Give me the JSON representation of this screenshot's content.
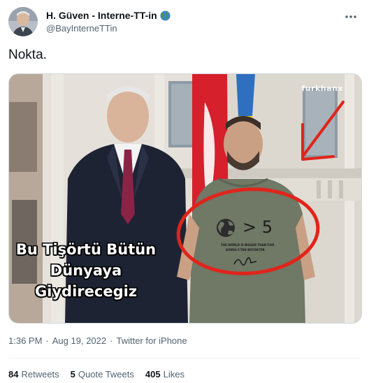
{
  "user": {
    "display_name": "H. Güven - Interne-TT-in",
    "handle": "@BayInterneTTin",
    "badge_icon": "globe-emoji-icon"
  },
  "tweet": {
    "text": "Nokta."
  },
  "media": {
    "watermark": "furkhanx",
    "caption_lines": [
      "Bu Tişörtü Bütün",
      "Dünyaya",
      "Giydirecegiz"
    ],
    "shirt_symbol": "> 5",
    "shirt_small_line1": "THE WORLD IS BIGGER THAN FIVE",
    "shirt_small_line2": "DÜNYA 5'TEN BÜYÜKTÜR",
    "annotation_color": "#e0241b"
  },
  "meta": {
    "time": "1:36 PM",
    "separator": "·",
    "date": "Aug 19, 2022",
    "source": "Twitter for iPhone"
  },
  "stats": {
    "retweets_count": "84",
    "retweets_label": "Retweets",
    "quotes_count": "5",
    "quotes_label": "Quote Tweets",
    "likes_count": "405",
    "likes_label": "Likes"
  },
  "colors": {
    "text_primary": "#0f1419",
    "text_secondary": "#536471",
    "border": "#cfd9de"
  }
}
